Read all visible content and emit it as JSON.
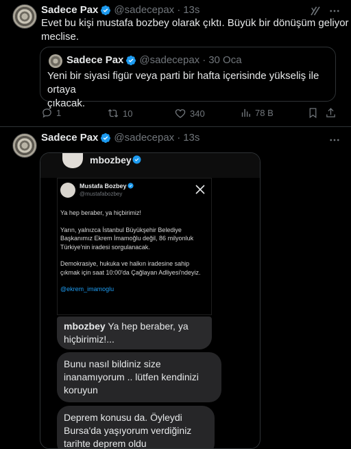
{
  "tweet1": {
    "author_name": "Sadece Pax",
    "handle": "@sadecepax",
    "time": "13s",
    "text_line1": "Evet bu kişi mustafa bozbey olarak çıktı. Büyük bir dönüşüm geliyor",
    "text_line2": "meclise.",
    "quote": {
      "author_name": "Sadece Pax",
      "handle": "@sadecepax",
      "date": "30 Oca",
      "text_line1": "Yeni bir siyasi figür veya parti bir hafta içerisinde yükseliş ile ortaya",
      "text_line2": "çıkacak."
    },
    "actions": {
      "replies": "1",
      "reposts": "10",
      "likes": "340",
      "views": "78 B"
    }
  },
  "tweet2": {
    "author_name": "Sadece Pax",
    "handle": "@sadecepax",
    "time": "13s",
    "media": {
      "story_username": "mbozbey",
      "card": {
        "name": "Mustafa Bozbey",
        "handle": "@mustafabozbey",
        "p1": "Ya hep beraber, ya hiçbirimiz!",
        "p2": "Yarın, yalnızca İstanbul Büyükşehir Belediye Başkanımız Ekrem İmamoğlu değil, 86 milyonluk Türkiye'nin iradesi sorgulanacak.",
        "p3": "Demokrasiye, hukuka ve halkın iradesine sahip çıkmak için saat 10:00'da Çağlayan Adliyesi'ndeyiz.",
        "tag": "@ekrem_imamoglu"
      },
      "reply_name": "mbozbey",
      "reply_text_a": "Ya hep beraber, ya",
      "reply_text_b": "hiçbirimiz!...",
      "msg1_l1": "Bunu nasıl bildiniz size",
      "msg1_l2": "inanamıyorum .. lütfen kendinizi",
      "msg1_l3": "koruyun",
      "msg2_l1": "Deprem konusu da. Öyleydi",
      "msg2_l2": "Bursa'da yaşıyorum verdiğiniz",
      "msg2_l3": "tarihte deprem oldu"
    }
  },
  "colors": {
    "background": "#000000",
    "text": "#e7e9ea",
    "muted": "#71767b",
    "verified": "#1d9bf0",
    "divider": "#2f3336"
  }
}
